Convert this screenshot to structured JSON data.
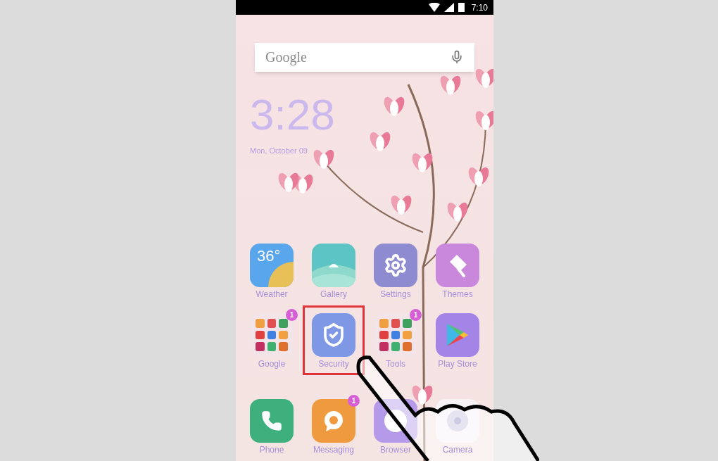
{
  "status_bar": {
    "time": "7:10"
  },
  "search": {
    "placeholder": "Google"
  },
  "clock": {
    "time": "3:28",
    "date": "Mon, October 09"
  },
  "apps": [
    {
      "label": "Weather",
      "kind": "weather",
      "temperature": "36°",
      "highlighted": false
    },
    {
      "label": "Gallery",
      "kind": "gallery",
      "highlighted": false
    },
    {
      "label": "Settings",
      "kind": "settings",
      "highlighted": false
    },
    {
      "label": "Themes",
      "kind": "themes",
      "highlighted": false
    },
    {
      "label": "Google",
      "kind": "folder",
      "badge": "1",
      "highlighted": false
    },
    {
      "label": "Security",
      "kind": "security",
      "highlighted": true
    },
    {
      "label": "Tools",
      "kind": "folder",
      "badge": "1",
      "highlighted": false
    },
    {
      "label": "Play Store",
      "kind": "play",
      "highlighted": false
    }
  ],
  "dock": [
    {
      "label": "Phone",
      "kind": "phone"
    },
    {
      "label": "Messaging",
      "kind": "messaging",
      "badge": "1"
    },
    {
      "label": "Browser",
      "kind": "browser"
    },
    {
      "label": "Camera",
      "kind": "camera"
    }
  ]
}
